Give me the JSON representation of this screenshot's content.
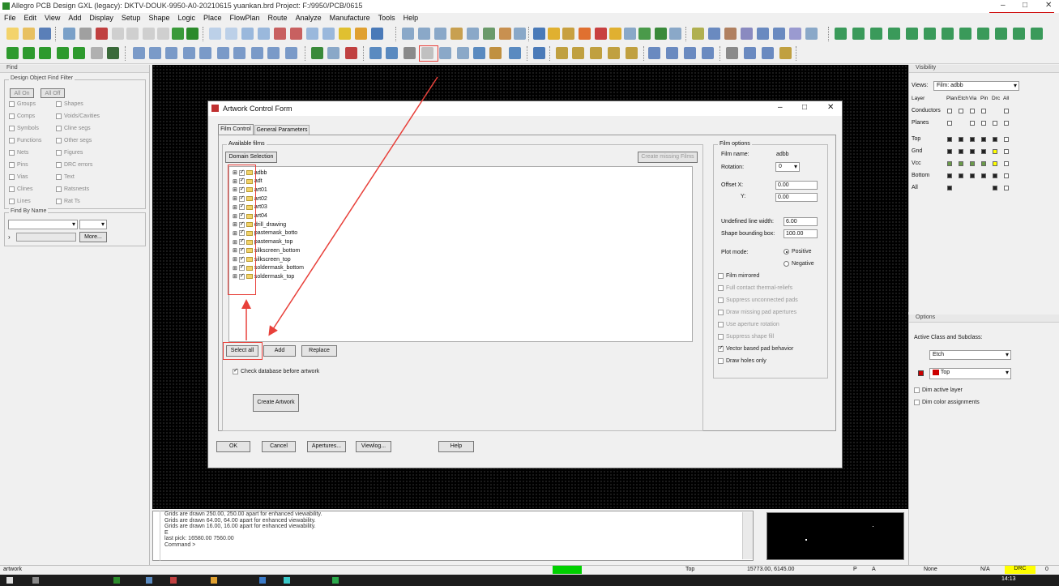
{
  "window": {
    "title": "Allegro PCB Design GXL (legacy): DKTV-DOUK-9950-A0-20210615 yuankan.brd  Project: F:/9950/PCB/0615",
    "brand": "cadence",
    "controls": {
      "minimize": "–",
      "maximize": "□",
      "close": "✕"
    }
  },
  "menubar": [
    "File",
    "Edit",
    "View",
    "Add",
    "Display",
    "Setup",
    "Shape",
    "Logic",
    "Place",
    "FlowPlan",
    "Route",
    "Analyze",
    "Manufacture",
    "Tools",
    "Help"
  ],
  "find_panel": {
    "title": "Find",
    "group_title": "Design Object Find Filter",
    "all_on": "All On",
    "all_off": "All Off",
    "left_items": [
      "Groups",
      "Comps",
      "Symbols",
      "Functions",
      "Nets",
      "Pins",
      "Vias",
      "Clines",
      "Lines"
    ],
    "right_items": [
      "Shapes",
      "Voids/Cavities",
      "Cline segs",
      "Other segs",
      "Figures",
      "DRC errors",
      "Text",
      "Ratsnests",
      "Rat Ts"
    ],
    "find_by_name": "Find By Name",
    "more": "More..."
  },
  "visibility": {
    "title": "Visibility",
    "views_label": "Views:",
    "views_value": "Film: adbb",
    "headers": [
      "Layer",
      "Plan",
      "Etch",
      "Via",
      "Pin",
      "Drc",
      "All"
    ],
    "rows": [
      "Conductors",
      "Planes",
      "Top",
      "Gnd",
      "Vcc",
      "Bottom",
      "All"
    ]
  },
  "options": {
    "title": "Options",
    "active_class_label": "Active Class and Subclass:",
    "class_value": "Etch",
    "subclass_value": "Top",
    "dim_active_layer": "Dim active layer",
    "dim_color_assignments": "Dim color assignments"
  },
  "dialog": {
    "title": "Artwork Control Form",
    "tabs": [
      "Film Control",
      "General Parameters"
    ],
    "available_films_label": "Available films",
    "domain_selection": "Domain Selection",
    "create_missing_films": "Create missing Films",
    "films": [
      "adbb",
      "adt",
      "art01",
      "art02",
      "art03",
      "art04",
      "drill_drawing",
      "pastemask_botto",
      "pastemask_top",
      "silkscreen_bottom",
      "silkscreen_top",
      "soldermask_bottom",
      "soldermask_top"
    ],
    "select_all": "Select all",
    "add": "Add",
    "replace": "Replace",
    "check_database": "Check database before artwork",
    "create_artwork": "Create Artwork",
    "bottom_buttons": [
      "OK",
      "Cancel",
      "Apertures...",
      "Viewlog...",
      "Help"
    ],
    "film_options": {
      "title": "Film options",
      "film_name_label": "Film name:",
      "film_name": "adbb",
      "rotation_label": "Rotation:",
      "rotation": "0",
      "offset_x_label": "Offset  X:",
      "offset_x": "0.00",
      "offset_y_label": "Y:",
      "offset_y": "0.00",
      "undefined_line_width_label": "Undefined line width:",
      "undefined_line_width": "6.00",
      "shape_bounding_box_label": "Shape bounding box:",
      "shape_bounding_box": "100.00",
      "plot_mode_label": "Plot mode:",
      "positive": "Positive",
      "negative": "Negative",
      "checkboxes": [
        "Film mirrored",
        "Full contact thermal-reliefs",
        "Suppress unconnected pads",
        "Draw missing pad apertures",
        "Use aperture rotation",
        "Suppress shape fill",
        "Vector based pad behavior",
        "Draw holes only"
      ],
      "checked": [
        false,
        false,
        false,
        false,
        false,
        false,
        true,
        false
      ]
    }
  },
  "command_log": [
    "Grids are drawn 250.00, 250.00 apart for enhanced viewability.",
    "Grids are drawn 64.00, 64.00 apart for enhanced viewability.",
    "Grids are drawn 16.00, 16.00 apart for enhanced viewability.",
    "E",
    "last pick:  16580.00 7560.00",
    "Command >"
  ],
  "statusbar": {
    "mode": "artwork",
    "subclass": "Top",
    "coords": "15773.00, 6145.00",
    "pointer": "P",
    "abs": "A",
    "state": "None",
    "na": "N/A",
    "drc": "DRC",
    "counter": "0"
  },
  "taskbar": {
    "time": "14:13"
  },
  "colors": {
    "canvas": "#000000",
    "annotation": "#e8403a",
    "yellow": "#ffff00",
    "green": "#00d000"
  }
}
